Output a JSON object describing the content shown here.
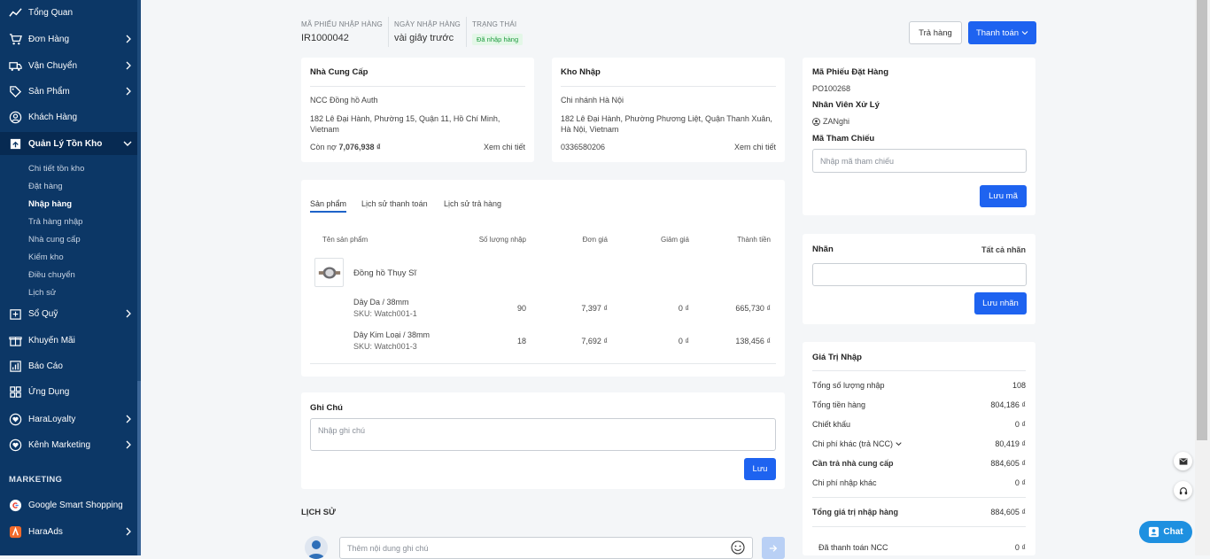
{
  "sidebar": {
    "items": [
      {
        "label": "Tổng Quan",
        "icon": "chart-line-icon"
      },
      {
        "label": "Đơn Hàng",
        "icon": "cart-icon"
      },
      {
        "label": "Vận Chuyển",
        "icon": "truck-icon"
      },
      {
        "label": "Sản Phẩm",
        "icon": "tag-icon"
      },
      {
        "label": "Khách Hàng",
        "icon": "user-circle-icon"
      },
      {
        "label": "Quản Lý Tồn Kho",
        "icon": "warehouse-box-icon"
      },
      {
        "label": "Sổ Quỹ",
        "icon": "cashbook-icon"
      },
      {
        "label": "Khuyến Mãi",
        "icon": "gift-icon"
      },
      {
        "label": "Báo Cáo",
        "icon": "report-icon"
      },
      {
        "label": "Ứng Dụng",
        "icon": "apps-grid-icon"
      },
      {
        "label": "HaraLoyalty",
        "icon": "heart-icon"
      },
      {
        "label": "Kênh Marketing",
        "icon": "heart-icon"
      }
    ],
    "subitems": [
      "Chi tiết tồn kho",
      "Đặt hàng",
      "Nhập hàng",
      "Trả hàng nhập",
      "Nhà cung cấp",
      "Kiểm kho",
      "Điều chuyển",
      "Lịch sử"
    ],
    "section": "MARKETING",
    "marketing": [
      {
        "label": "Google Smart Shopping"
      },
      {
        "label": "HaraAds"
      }
    ]
  },
  "header": {
    "code_label": "MÃ PHIẾU NHẬP HÀNG",
    "code": "IR1000042",
    "date_label": "NGÀY NHẬP HÀNG",
    "date": "vài giây trước",
    "status_label": "TRẠNG THÁI",
    "status": "Đã nhập hàng",
    "return_btn": "Trả hàng",
    "pay_btn": "Thanh toán"
  },
  "supplier": {
    "title": "Nhà Cung Cấp",
    "name": "NCC Đồng hồ Auth",
    "address": "182 Lê Đại Hành, Phường 15, Quận 11, Hồ Chí Minh, Vietnam",
    "debt_label": "Còn nợ",
    "debt": "7,076,938 ₫",
    "link": "Xem chi tiết"
  },
  "warehouse": {
    "title": "Kho Nhập",
    "name": "Chi nhánh Hà Nội",
    "address": "182 Lê Đại Hành, Phường Phương Liệt, Quận Thanh Xuân, Hà Nội, Vietnam",
    "phone": "0336580206",
    "link": "Xem chi tiết"
  },
  "tabs": [
    "Sản phẩm",
    "Lịch sử thanh toán",
    "Lịch sử trả hàng"
  ],
  "table": {
    "headers": [
      "Tên sản phẩm",
      "Số lượng nhập",
      "Đơn giá",
      "Giảm giá",
      "Thành tiền"
    ],
    "product": "Đồng hồ Thụy Sĩ",
    "rows": [
      {
        "variant": "Dây Da / 38mm",
        "sku": "SKU: Watch001-1",
        "qty": "90",
        "price": "7,397 ₫",
        "discount": "0 ₫",
        "total": "665,730 ₫"
      },
      {
        "variant": "Dây Kim Loại / 38mm",
        "sku": "SKU: Watch001-3",
        "qty": "18",
        "price": "7,692 ₫",
        "discount": "0 ₫",
        "total": "138,456 ₫"
      }
    ]
  },
  "note": {
    "title": "Ghi Chú",
    "placeholder": "Nhập ghi chú",
    "save": "Lưu"
  },
  "history": {
    "title": "LỊCH SỬ",
    "placeholder": "Thêm nội dung ghi chú"
  },
  "po": {
    "title": "Mã Phiếu Đặt Hàng",
    "code": "PO100268",
    "staff_title": "Nhân Viên Xử Lý",
    "staff": "ZANghi",
    "ref_title": "Mã Tham Chiếu",
    "ref_placeholder": "Nhập mã tham chiếu",
    "save": "Lưu mã"
  },
  "tags": {
    "title": "Nhãn",
    "all": "Tất cả nhãn",
    "save": "Lưu nhãn"
  },
  "value": {
    "title": "Giá Trị Nhập",
    "rows": [
      {
        "label": "Tổng số lượng nhập",
        "value": "108"
      },
      {
        "label": "Tổng tiền hàng",
        "value": "804,186 ₫"
      },
      {
        "label": "Chiết khấu",
        "value": "0 ₫"
      },
      {
        "label": "Chi phí khác (trả NCC)",
        "value": "80,419 ₫"
      },
      {
        "label": "Cần trả nhà cung cấp",
        "value": "884,605 ₫"
      },
      {
        "label": "Chi phí nhập khác",
        "value": "0 ₫"
      }
    ],
    "total_label": "Tổng giá trị nhập hàng",
    "total": "884,605 ₫",
    "paid_label": "Đã thanh toán NCC",
    "paid": "0 ₫"
  },
  "chat": {
    "label": "Chat"
  }
}
